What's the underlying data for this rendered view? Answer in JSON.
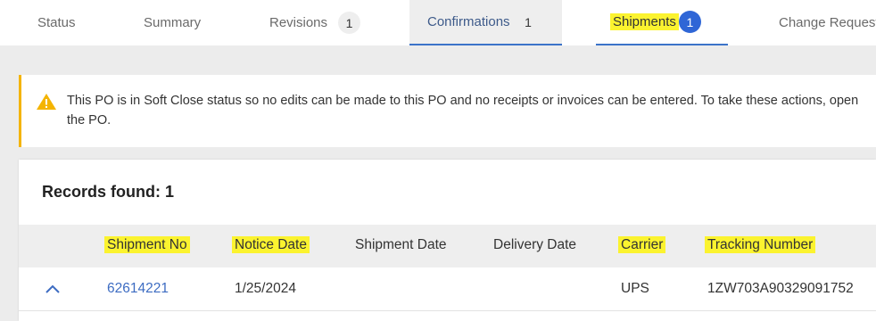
{
  "tabs": [
    {
      "label": "Status",
      "count": null
    },
    {
      "label": "Summary",
      "count": null
    },
    {
      "label": "Revisions",
      "count": "1"
    },
    {
      "label": "Confirmations",
      "count": "1"
    },
    {
      "label": "Shipments",
      "count": "1"
    },
    {
      "label": "Change Request",
      "count": null
    }
  ],
  "alert": {
    "icon": "warning-icon",
    "message": "This PO is in Soft Close status so no edits can be made to this PO and no receipts or invoices can be entered. To take these actions, open the PO."
  },
  "records": {
    "label": "Records found: 1"
  },
  "table": {
    "columns": [
      "Shipment No",
      "Notice Date",
      "Shipment Date",
      "Delivery Date",
      "Carrier",
      "Tracking Number"
    ],
    "rows": [
      {
        "shipment_no": "62614221",
        "notice_date": "1/25/2024",
        "shipment_date": "",
        "delivery_date": "",
        "carrier": "UPS",
        "tracking_number": "1ZW703A90329091752"
      }
    ]
  },
  "colors": {
    "highlight": "#fbf32f",
    "accent_blue": "#3b73c9",
    "badge_blue": "#2f66d6",
    "warning": "#f4b400",
    "link": "#3d6cc2"
  }
}
